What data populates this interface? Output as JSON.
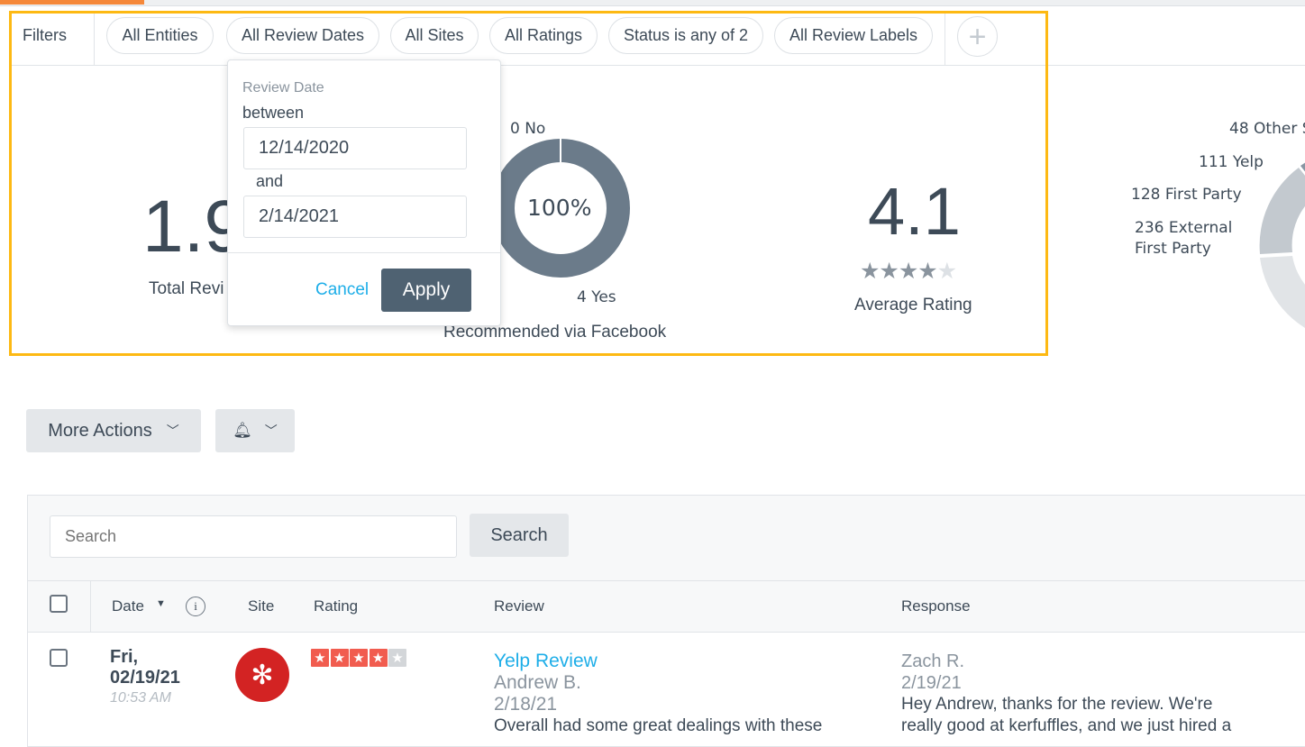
{
  "filters": {
    "label": "Filters",
    "pills": [
      "All Entities",
      "All Review Dates",
      "All Sites",
      "All Ratings",
      "Status is any of 2",
      "All Review Labels"
    ],
    "add_icon": "plus-icon"
  },
  "date_popup": {
    "title": "Review Date",
    "between": "between",
    "start": "12/14/2020",
    "and": "and",
    "end": "2/14/2021",
    "cancel": "Cancel",
    "apply": "Apply"
  },
  "stats": {
    "total": {
      "value": "1.9",
      "label": "Total Revi"
    },
    "facebook": {
      "no_label": "0 No",
      "yes_label": "4 Yes",
      "center": "100%",
      "label": "Recommended via Facebook",
      "yes": 4,
      "no": 0
    },
    "average": {
      "value": "4.1",
      "label": "Average Rating",
      "rating": 4.1
    },
    "sites": {
      "labels": [
        "48 Other S",
        "111 Yelp",
        "128 First Party",
        "236 External",
        "First Party"
      ],
      "values": {
        "other": 48,
        "yelp": 111,
        "first_party": 128,
        "external_first_party": 236
      }
    }
  },
  "colors": {
    "accent": "#f5883a",
    "focus": "#fdb913",
    "link": "#1eaee8",
    "apply": "#4f6272",
    "yelp": "#d32323"
  },
  "actions": {
    "more": "More Actions",
    "bell_icon": "bell-icon"
  },
  "search": {
    "placeholder": "Search",
    "button": "Search"
  },
  "table": {
    "headers": [
      "Date",
      "Site",
      "Rating",
      "Review",
      "Response"
    ],
    "rows": [
      {
        "day": "Fri,",
        "date": "02/19/21",
        "time": "10:53 AM",
        "site": "Yelp",
        "rating": 4,
        "review_title": "Yelp Review",
        "author": "Andrew B.",
        "review_date": "2/18/21",
        "review_text": "Overall had some great dealings with these",
        "responder": "Zach R.",
        "response_date": "2/19/21",
        "response_text1": "Hey Andrew, thanks for the review. We're",
        "response_text2": "really good at kerfuffles, and we just hired a"
      }
    ]
  }
}
